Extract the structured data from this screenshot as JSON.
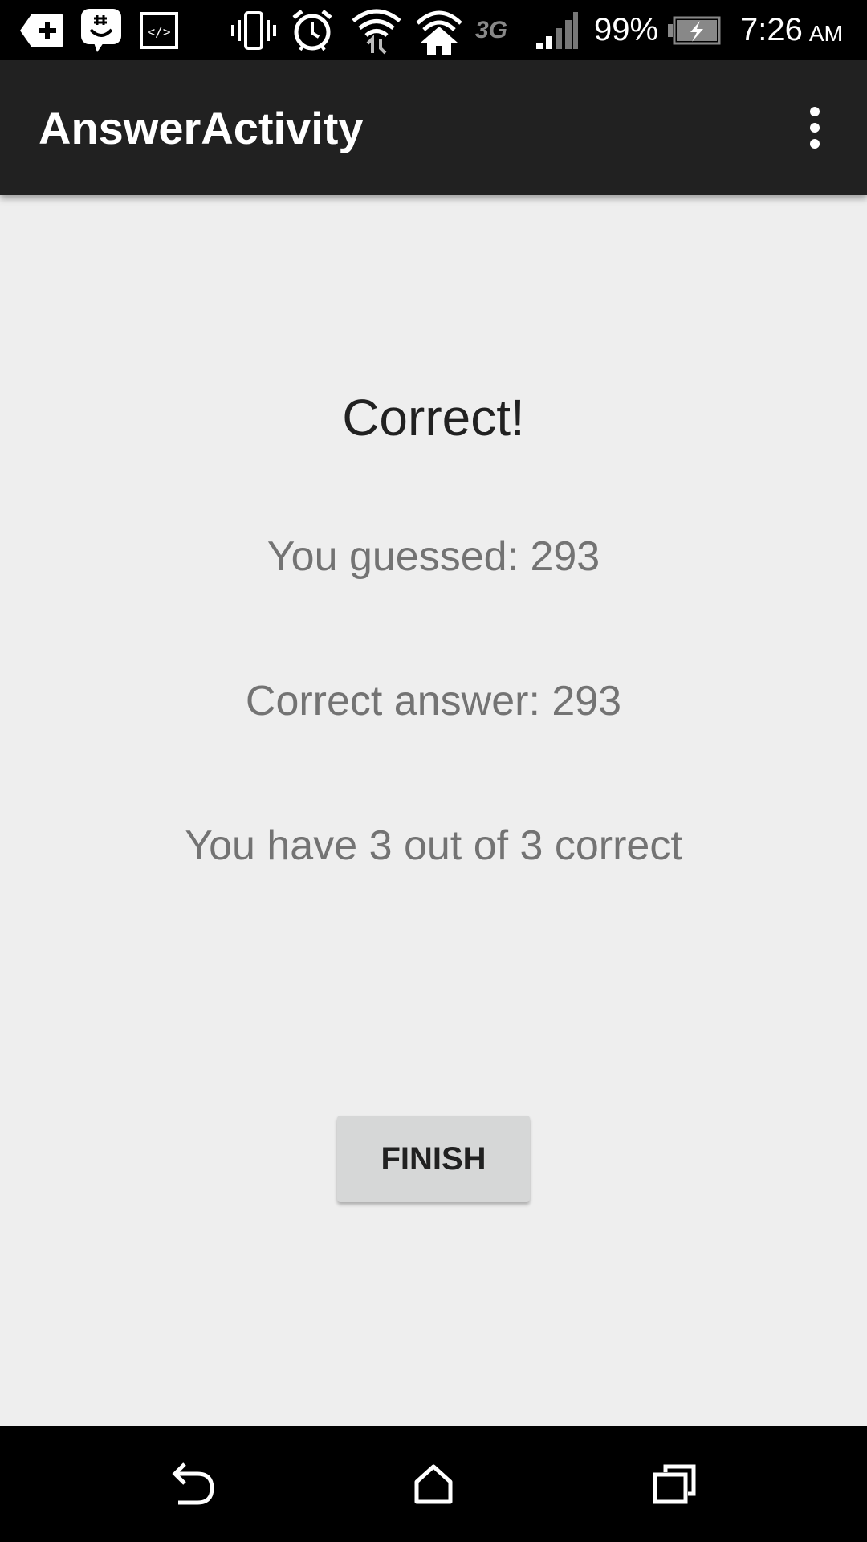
{
  "status_bar": {
    "battery": "99%",
    "network": "3G",
    "time": "7:26",
    "time_suffix": "AM",
    "icons": [
      "add-notification-icon",
      "messenger-icon",
      "code-icon",
      "vibrate-icon",
      "alarm-icon",
      "wifi-icon",
      "wifi-hotspot-icon",
      "signal-icon",
      "battery-charging-icon"
    ]
  },
  "app_bar": {
    "title": "AnswerActivity",
    "overflow_icon": "more-vert-icon"
  },
  "result": {
    "title": "Correct!",
    "guessed": "You guessed: 293",
    "answer": "Correct answer: 293",
    "score": "You have 3 out of 3 correct"
  },
  "actions": {
    "finish_label": "FINISH"
  },
  "nav_bar": {
    "icons": [
      "back-icon",
      "home-icon",
      "recents-icon"
    ]
  },
  "colors": {
    "status_bar": "#000000",
    "app_bar": "#212121",
    "background": "#eeeeee",
    "title_text": "#212121",
    "body_text": "#737373",
    "button_bg": "#d6d7d7"
  }
}
